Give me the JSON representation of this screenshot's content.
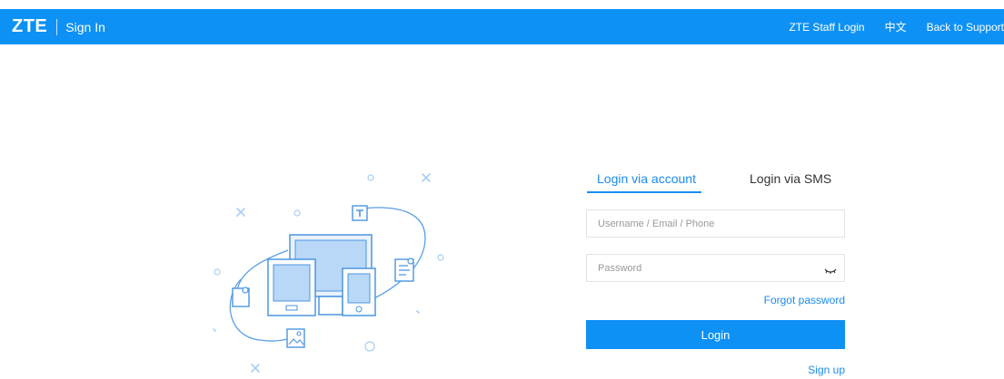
{
  "header": {
    "logo": "ZTE",
    "title": "Sign In",
    "nav": {
      "staff_login": "ZTE Staff Login",
      "language": "中文",
      "back_to_support": "Back to Support"
    }
  },
  "login": {
    "tabs": {
      "account": "Login via account",
      "sms": "Login via SMS"
    },
    "active_tab": "account",
    "username_placeholder": "Username / Email / Phone",
    "password_placeholder": "Password",
    "forgot_password": "Forgot password",
    "login_button": "Login",
    "sign_up": "Sign up"
  },
  "colors": {
    "header_bg": "#0e91f5",
    "accent": "#1a8cf0",
    "illustration_stroke": "#5a9fe3",
    "illustration_fill": "#b9d8f7"
  },
  "icons": {
    "password_toggle": "eye-closed-icon",
    "illustration": "devices-illustration"
  }
}
